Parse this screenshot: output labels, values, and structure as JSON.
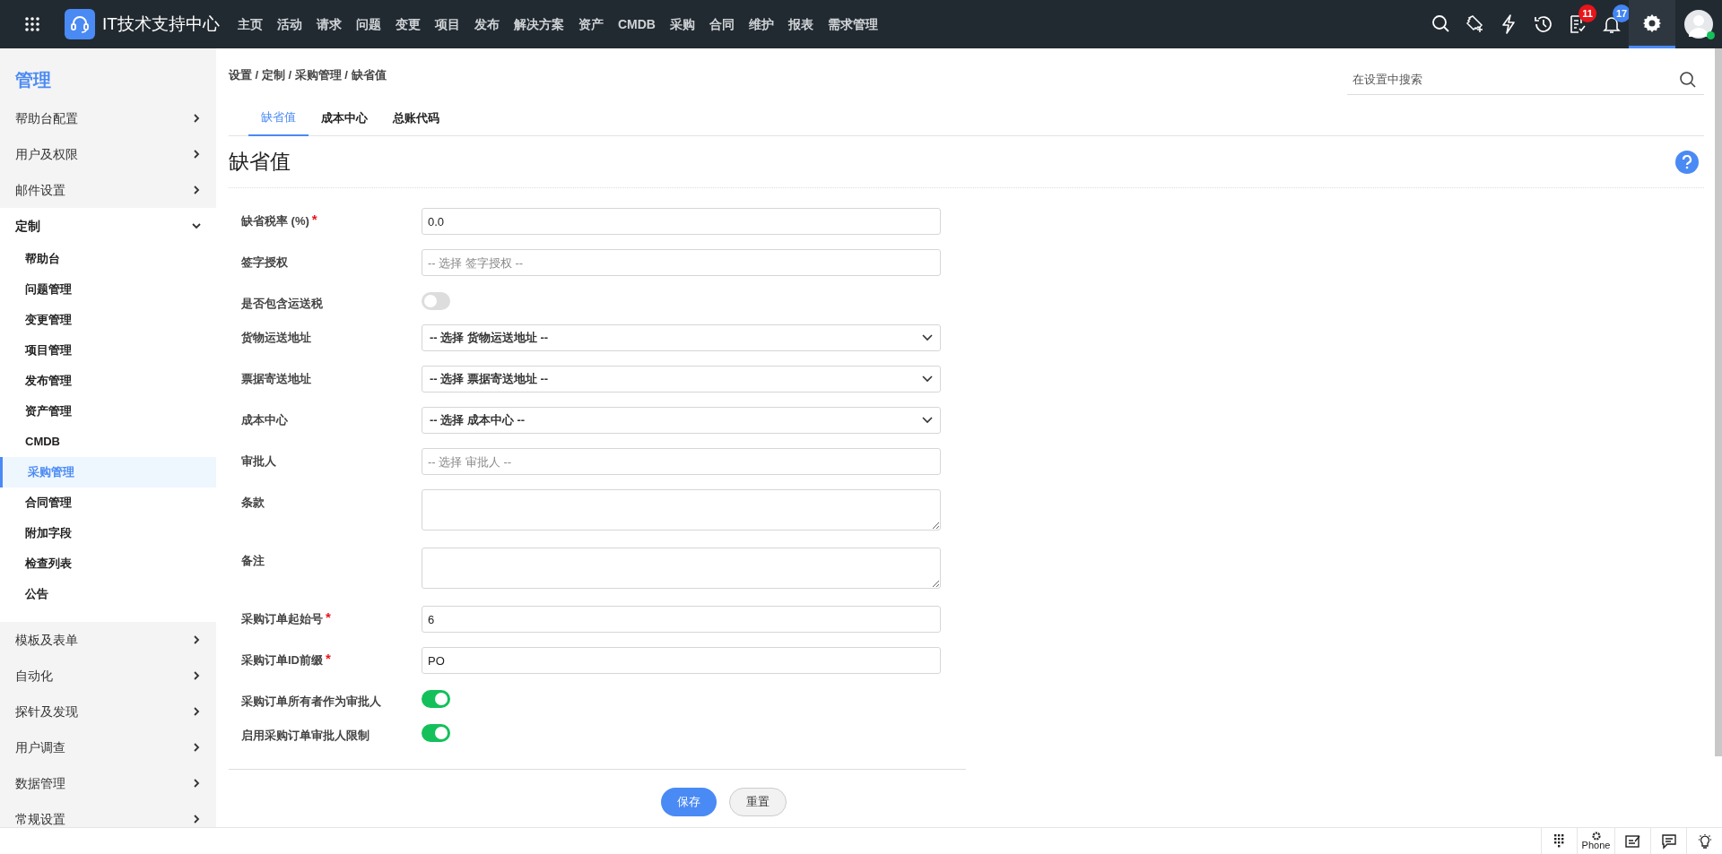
{
  "app": {
    "title": "IT技术支持中心"
  },
  "nav": [
    {
      "label": "主页"
    },
    {
      "label": "活动"
    },
    {
      "label": "请求"
    },
    {
      "label": "问题"
    },
    {
      "label": "变更"
    },
    {
      "label": "项目"
    },
    {
      "label": "发布"
    },
    {
      "label": "解决方案"
    },
    {
      "label": "资产"
    },
    {
      "label": "CMDB"
    },
    {
      "label": "采购"
    },
    {
      "label": "合同"
    },
    {
      "label": "维护"
    },
    {
      "label": "报表"
    },
    {
      "label": "需求管理"
    }
  ],
  "toolbar": [
    {
      "kind": "search",
      "selected": false
    },
    {
      "kind": "ticket",
      "selected": false
    },
    {
      "kind": "bolt",
      "selected": false
    },
    {
      "kind": "history",
      "selected": false
    },
    {
      "kind": "tasks",
      "selected": false,
      "badge": "11",
      "color": "#e8151b"
    },
    {
      "kind": "bell",
      "selected": false,
      "badge": "17",
      "color": "#4285f4"
    },
    {
      "kind": "settings",
      "selected": true
    }
  ],
  "user": {
    "online": true
  },
  "sidebar": {
    "heading": "管理",
    "groups": [
      {
        "label": "帮助台配置",
        "expanded": false
      },
      {
        "label": "用户及权限",
        "expanded": false
      },
      {
        "label": "邮件设置",
        "expanded": false
      },
      {
        "label": "定制",
        "expanded": true,
        "children": [
          {
            "label": "帮助台",
            "selected": false
          },
          {
            "label": "问题管理",
            "selected": false
          },
          {
            "label": "变更管理",
            "selected": false
          },
          {
            "label": "项目管理",
            "selected": false
          },
          {
            "label": "发布管理",
            "selected": false
          },
          {
            "label": "资产管理",
            "selected": false
          },
          {
            "label": "CMDB",
            "selected": false
          },
          {
            "label": "采购管理",
            "selected": true
          },
          {
            "label": "合同管理",
            "selected": false
          },
          {
            "label": "附加字段",
            "selected": false
          },
          {
            "label": "检查列表",
            "selected": false
          },
          {
            "label": "公告",
            "selected": false
          }
        ]
      },
      {
        "label": "模板及表单",
        "expanded": false
      },
      {
        "label": "自动化",
        "expanded": false
      },
      {
        "label": "探针及发现",
        "expanded": false
      },
      {
        "label": "用户调查",
        "expanded": false
      },
      {
        "label": "数据管理",
        "expanded": false
      },
      {
        "label": "常规设置",
        "expanded": false
      }
    ]
  },
  "breadcrumb": "设置 / 定制 / 采购管理 / 缺省值",
  "search": {
    "placeholder": "在设置中搜索"
  },
  "tabs": [
    {
      "label": "缺省值",
      "selected": true
    },
    {
      "label": "成本中心",
      "selected": false
    },
    {
      "label": "总账代码",
      "selected": false
    }
  ],
  "section_title": "缺省值",
  "form": [
    {
      "kind": "text",
      "label": "缺省税率 (%)",
      "required": true,
      "required_mark": "*",
      "value": "0.0"
    },
    {
      "kind": "text",
      "label": "签字授权",
      "required": false,
      "placeholder": "-- 选择 签字授权 --"
    },
    {
      "kind": "toggle",
      "label": "是否包含运送税",
      "on": false
    },
    {
      "kind": "select",
      "label": "货物运送地址",
      "value": "-- 选择 货物运送地址 --"
    },
    {
      "kind": "select",
      "label": "票据寄送地址",
      "value": "-- 选择 票据寄送地址 --"
    },
    {
      "kind": "select",
      "label": "成本中心",
      "value": "-- 选择 成本中心 --"
    },
    {
      "kind": "text",
      "label": "审批人",
      "required": false,
      "placeholder": "-- 选择 审批人 --"
    },
    {
      "kind": "textarea",
      "label": "条款"
    },
    {
      "kind": "textarea",
      "label": "备注"
    },
    {
      "kind": "text",
      "label": "采购订单起始号",
      "required": true,
      "required_mark": "*",
      "value": "6"
    },
    {
      "kind": "text",
      "label": "采购订单ID前缀",
      "required": true,
      "required_mark": "*",
      "value": "PO"
    },
    {
      "kind": "toggle",
      "label": "采购订单所有者作为审批人",
      "on": true
    },
    {
      "kind": "toggle",
      "label": "启用采购订单审批人限制",
      "on": true
    }
  ],
  "buttons": [
    {
      "kind": "primary",
      "label": "保存"
    },
    {
      "kind": "secondary",
      "label": "重置"
    }
  ],
  "footer": {
    "phone_label": "Phone"
  }
}
